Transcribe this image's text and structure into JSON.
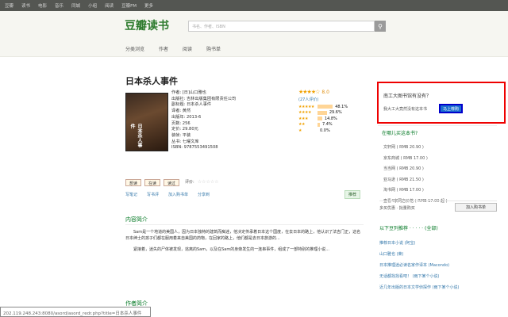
{
  "topnav": [
    "豆瓣",
    "读书",
    "电影",
    "音乐",
    "同城",
    "小组",
    "阅读",
    "豆瓣FM",
    "更多"
  ],
  "logo": "豆瓣读书",
  "search": {
    "placeholder": "书名、作者、ISBN"
  },
  "subnav": [
    "分类浏览",
    "作者",
    "阅读",
    "购书单"
  ],
  "book": {
    "title": "日本杀人事件",
    "cover_text": "日本杀人事件",
    "info": [
      "作者: [日]山口雅也",
      "出版社: 吉林出版集团有限责任公司",
      "副标题: 日本杀人事件",
      "译者: 黄然",
      "出版年: 2013-6",
      "页数: 256",
      "定价: 29.80元",
      "装帧: 平装",
      "丛书: 七曜文库",
      "ISBN: 9787553491508"
    ],
    "score": "8.0",
    "votes": "(27人评价)",
    "dist": [
      {
        "label": "48.1%",
        "v": 48.1
      },
      {
        "label": "29.6%",
        "v": 29.6
      },
      {
        "label": "14.8%",
        "v": 14.8
      },
      {
        "label": "7.4%",
        "v": 7.4
      },
      {
        "label": "0.0%",
        "v": 0
      }
    ]
  },
  "actions": [
    "想读",
    "在读",
    "读过"
  ],
  "rate_label": "评价:",
  "links": [
    "写笔记",
    "写书评",
    "加入购书单",
    "分享到"
  ],
  "recommend": "推荐",
  "intro_h": "内容简介",
  "intro": [
    "Sam是一个地道的美国人，因为日本独特的建筑而痴迷，他决定传承着日本这个国度，在去日本的路上，他认识了法吉门正，这名日本绅士的孩子们都在服用着来自美国的药物，在回家的路上，他们都是去日本旅游的...",
    "紧接着，迷失的尸体被发现，逃离的Sam，以及在Sam的身旁发生的一连串事件，组成了一部特别的推理小说..."
  ],
  "auth_h": "作者简介",
  "status": "202.119.248.243:8080/asord/asord_redr.php?title=日本杀人事件",
  "ask": {
    "title": "南工大图书馆有没有？",
    "text": "我大工大竟然没有这本书",
    "button": "马上荐购"
  },
  "where_h": "在哪儿买这本书?",
  "stores": [
    "文轩网 ( RMB 20.90 )",
    "京东商城 ( RMB 17.00 )",
    "当当网 ( RMB 20.90 )",
    "亚马逊 ( RMB 21.50 )",
    "淘书网 ( RMB 17.00 )",
    "查看4家网店价格 ( RMB 17.00 起 )"
  ],
  "buy": {
    "text": "多买优惠 · 批量购买",
    "button": "加入购书单"
  },
  "list_h": "以下豆列推荐 · · · · · (全部)",
  "lists": [
    "推荐日本小说 (阿宝)",
    "山口雅也 (莱)",
    "日本推理迷必读名家作译本 (Macondo)",
    "无话都找找看吧！ (雨下某个小说)",
    "近几年出版的日本文学侦探作 (雨下某个小说)"
  ]
}
